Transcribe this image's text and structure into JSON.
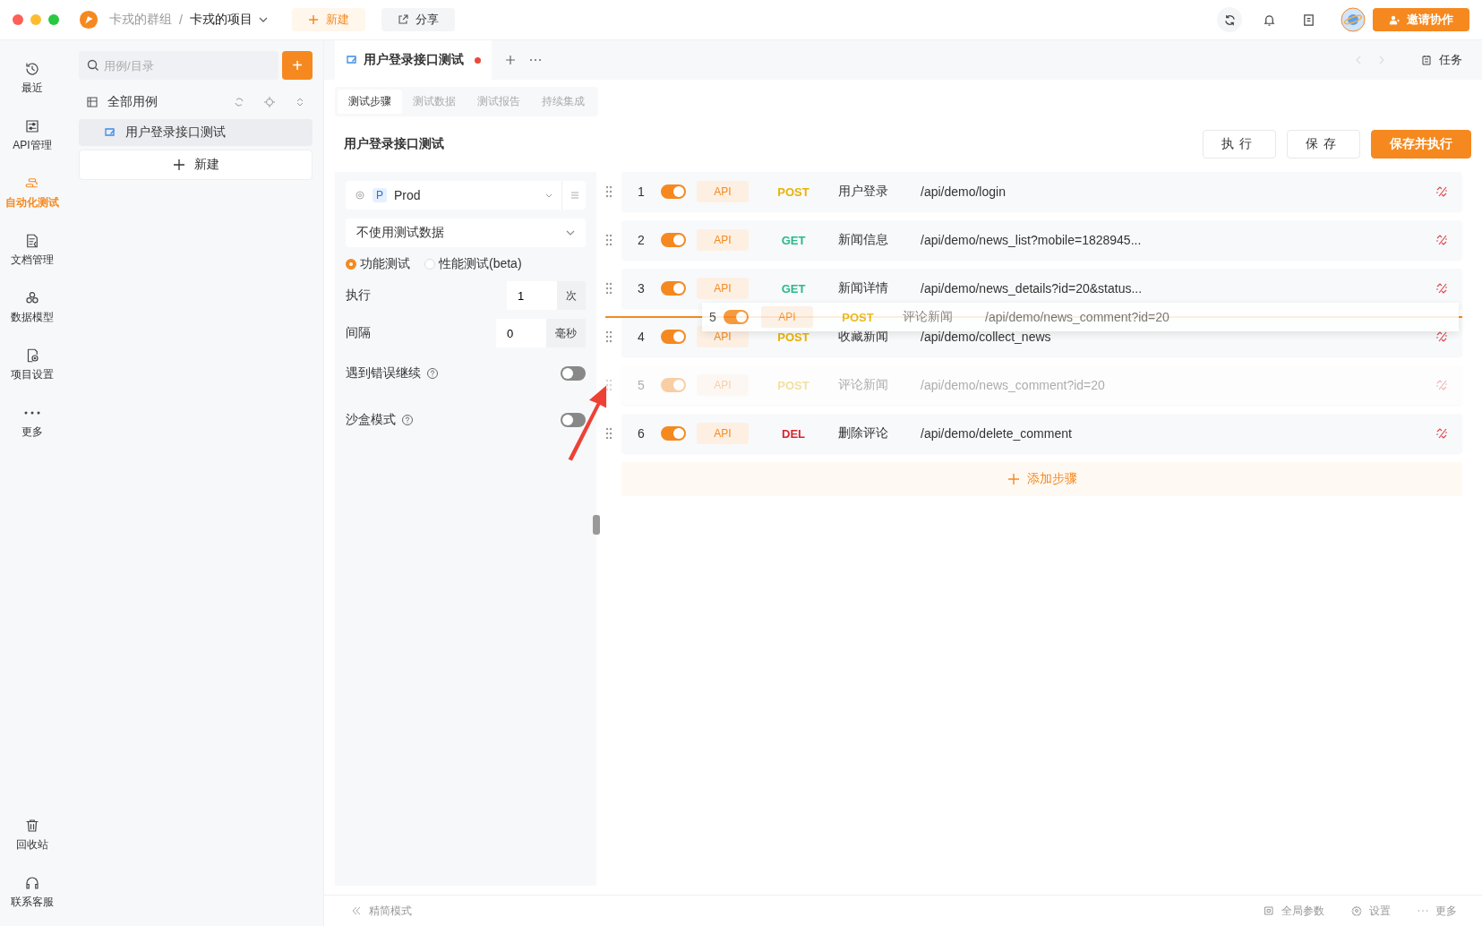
{
  "titlebar": {
    "group": "卡戎的群组",
    "separator": "/",
    "project": "卡戎的项目",
    "new_button": "新建",
    "share_button": "分享",
    "invite_button": "邀请协作"
  },
  "nav": [
    {
      "label": "最近",
      "selected": false
    },
    {
      "label": "API管理",
      "selected": false
    },
    {
      "label": "自动化测试",
      "selected": true
    },
    {
      "label": "文档管理",
      "selected": false
    },
    {
      "label": "数据模型",
      "selected": false
    },
    {
      "label": "项目设置",
      "selected": false
    },
    {
      "label": "更多",
      "selected": false
    }
  ],
  "nav_bottom": [
    {
      "label": "回收站"
    },
    {
      "label": "联系客服"
    }
  ],
  "case_sidebar": {
    "search_placeholder": "用例/目录",
    "add_button": "+",
    "root": {
      "label": "全部用例",
      "children": [
        {
          "label": "用户登录接口测试",
          "selected": true
        }
      ]
    },
    "new_button": "新建"
  },
  "tabs": [
    {
      "label": "用户登录接口测试",
      "unsaved": true
    }
  ],
  "task_button": "任务",
  "subtabs": [
    {
      "label": "测试步骤",
      "selected": true
    },
    {
      "label": "测试数据",
      "selected": false
    },
    {
      "label": "测试报告",
      "selected": false
    },
    {
      "label": "持续集成",
      "selected": false
    }
  ],
  "case_title": "用户登录接口测试",
  "actions": [
    {
      "label": "执行",
      "kind": "default"
    },
    {
      "label": "保存",
      "kind": "default"
    },
    {
      "label": "保存并执行",
      "kind": "primary"
    }
  ],
  "config": {
    "env_badge": "P",
    "env_name": "Prod",
    "data_select": "不使用测试数据",
    "modes": [
      {
        "label": "功能测试",
        "selected": true
      },
      {
        "label": "性能测试(beta)",
        "selected": false
      }
    ],
    "fields": [
      {
        "label": "执行",
        "value": "1",
        "unit": "次"
      },
      {
        "label": "间隔",
        "value": "0",
        "unit": "毫秒"
      }
    ],
    "switches": [
      {
        "label": "遇到错误继续",
        "on": false
      },
      {
        "label": "沙盒模式",
        "on": false
      }
    ]
  },
  "steps": [
    {
      "index": "1",
      "on": true,
      "type": "API",
      "method": "POST",
      "color": "#e8b400",
      "name": "用户登录",
      "path": "/api/demo/login",
      "dragging": false
    },
    {
      "index": "2",
      "on": true,
      "type": "API",
      "method": "GET",
      "color": "#29b98a",
      "name": "新闻信息",
      "path": "/api/demo/news_list?mobile=1828945...",
      "dragging": false
    },
    {
      "index": "3",
      "on": true,
      "type": "API",
      "method": "GET",
      "color": "#29b98a",
      "name": "新闻详情",
      "path": "/api/demo/news_details?id=20&status...",
      "dragging": false
    },
    {
      "index": "4",
      "on": true,
      "type": "API",
      "method": "POST",
      "color": "#e8b400",
      "name": "收藏新闻",
      "path": "/api/demo/collect_news",
      "dragging": false
    },
    {
      "index": "5",
      "on": true,
      "type": "API",
      "method": "POST",
      "color": "#f3e1a0",
      "name": "评论新闻",
      "path": "/api/demo/news_comment?id=20",
      "dragging": true
    },
    {
      "index": "6",
      "on": true,
      "type": "API",
      "method": "DEL",
      "color": "#d7262e",
      "name": "删除评论",
      "path": "/api/demo/delete_comment",
      "dragging": false
    }
  ],
  "drag_ghost": {
    "index": "5",
    "on": true,
    "type": "API",
    "method": "POST",
    "color": "#e8b400",
    "name": "评论新闻",
    "path": "/api/demo/news_comment?id=20"
  },
  "add_step": "添加步骤",
  "footer": {
    "compact_mode": "精简模式",
    "links": [
      {
        "label": "全局参数"
      },
      {
        "label": "设置"
      },
      {
        "label": "更多"
      }
    ]
  }
}
